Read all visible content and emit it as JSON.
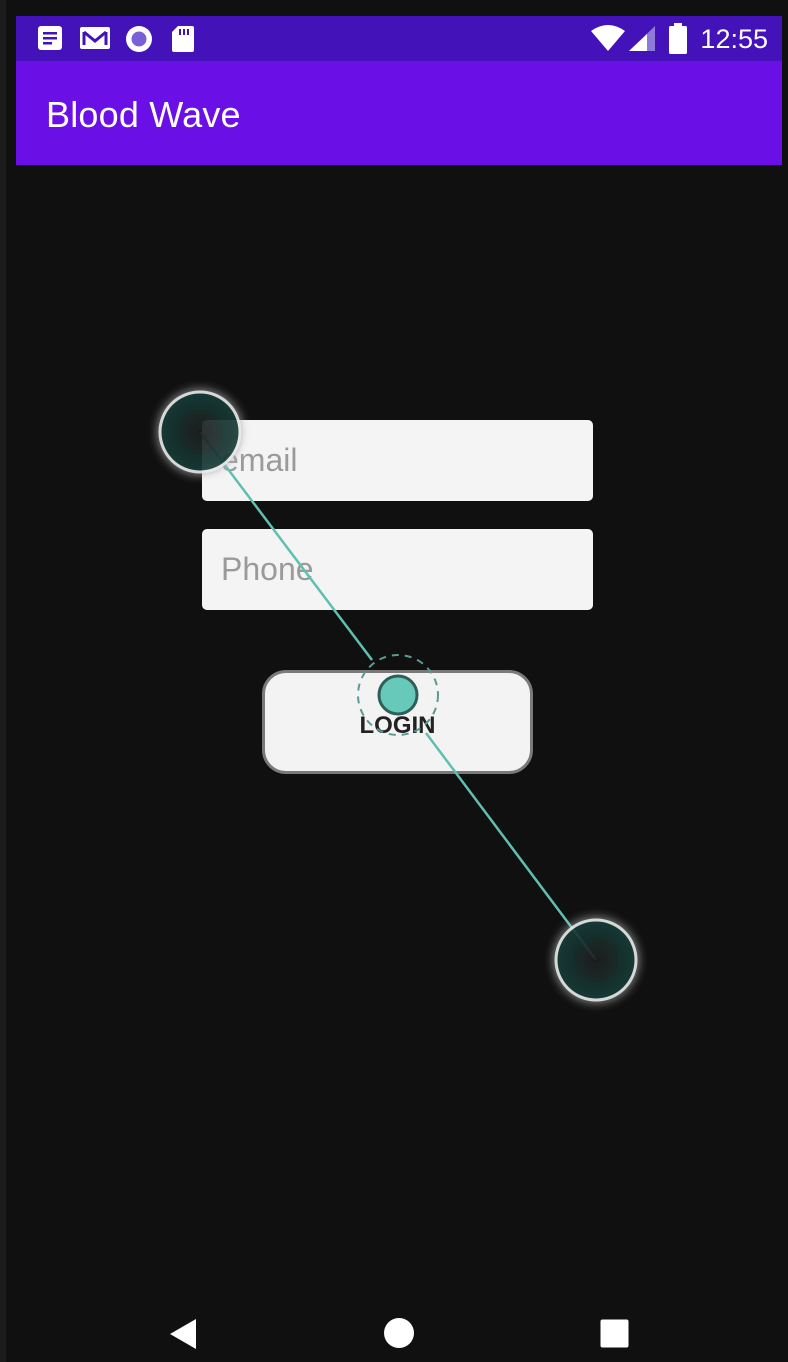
{
  "status_bar": {
    "time": "12:55",
    "left_icons": [
      "notes-icon",
      "gmail-icon",
      "circle-app-icon",
      "sd-card-icon"
    ],
    "right_icons": [
      "wifi-icon",
      "signal-icon",
      "battery-icon"
    ]
  },
  "app_bar": {
    "title": "Blood Wave"
  },
  "form": {
    "email_placeholder": "email",
    "email_value": "",
    "phone_placeholder": "Phone",
    "phone_value": "",
    "login_label": "LOGIN"
  },
  "nav_bar": {
    "icons": [
      "back-icon",
      "home-icon",
      "recents-icon"
    ]
  },
  "colors": {
    "status_bar": "#4312b9",
    "app_bar": "#6a10e6",
    "background": "#101010",
    "gesture_accent": "#5fbfb0"
  }
}
